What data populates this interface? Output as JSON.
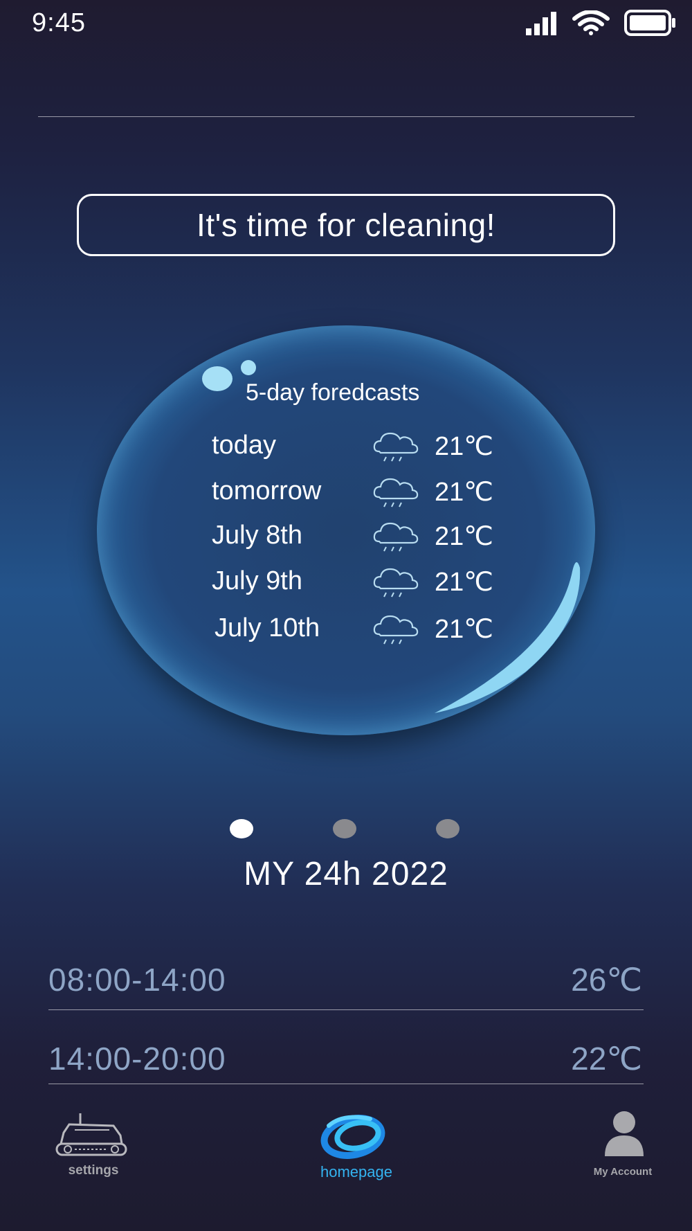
{
  "status_bar": {
    "time": "9:45",
    "icons": [
      "signal-icon",
      "wifi-icon",
      "battery-icon"
    ]
  },
  "banner": {
    "text": "It's time for cleaning!"
  },
  "forecast": {
    "title": "5-day foredcasts",
    "rows": [
      {
        "day": "today",
        "icon": "rain-cloud-icon",
        "temp": "21℃"
      },
      {
        "day": "tomorrow",
        "icon": "rain-cloud-icon",
        "temp": "21℃"
      },
      {
        "day": "July 8th",
        "icon": "rain-cloud-icon",
        "temp": "21℃"
      },
      {
        "day": "July 9th",
        "icon": "rain-cloud-icon",
        "temp": "21℃"
      },
      {
        "day": "July 10th",
        "icon": "rain-cloud-icon",
        "temp": "21℃"
      }
    ]
  },
  "pager": {
    "count": 3,
    "active_index": 0
  },
  "date_label": "MY 24h 2022",
  "time_slots": [
    {
      "range": "08:00-14:00",
      "temp": "26℃"
    },
    {
      "range": "14:00-20:00",
      "temp": "22℃"
    }
  ],
  "bottom_nav": {
    "settings": "settings",
    "homepage": "homepage",
    "account": "My Account"
  },
  "colors": {
    "accent": "#34b3f0",
    "muted_text": "#8ea5c6",
    "inactive_nav": "#a6a6ab"
  }
}
